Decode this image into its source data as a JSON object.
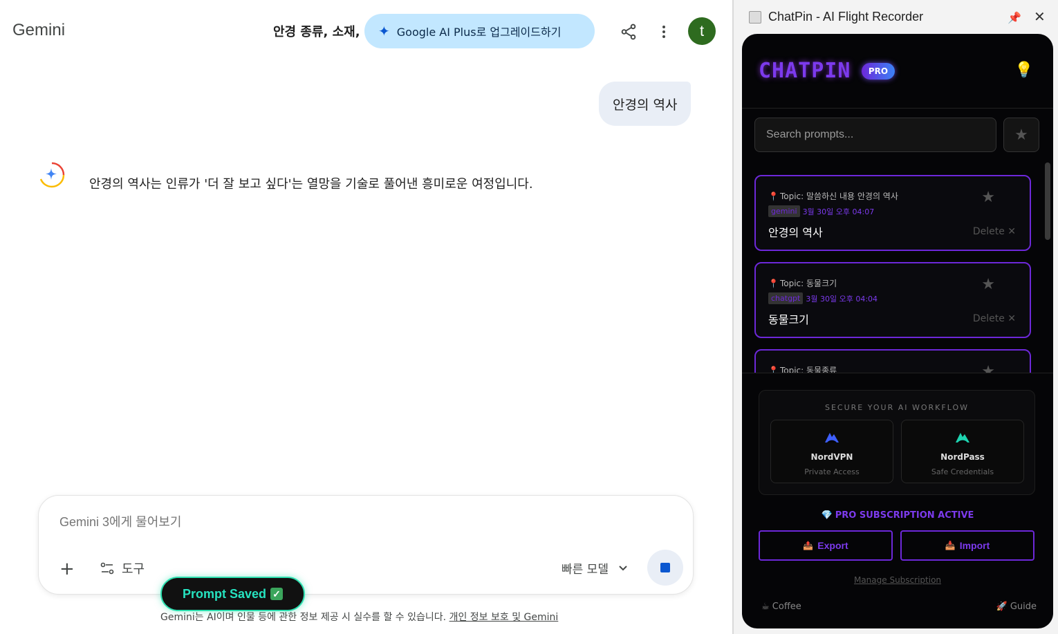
{
  "gemini": {
    "logo": "Gemini",
    "conversation_title": "안경 종류, 소재,",
    "upgrade_label": "Google AI Plus로 업그레이드하기",
    "avatar_initial": "t",
    "user_message": "안경의 역사",
    "answer": "안경의 역사는 인류가 '더 잘 보고 싶다'는 열망을 기술로 풀어낸 흥미로운 여정입니다.",
    "composer": {
      "placeholder": "Gemini 3에게 물어보기",
      "tools_label": "도구",
      "model_label": "빠른 모델"
    },
    "toast": "Prompt Saved",
    "disclaimer": "Gemini는 AI이며 인물 등에 관한 정보 제공 시 실수를 할 수 있습니다.",
    "disclaimer_link": "개인 정보 보호 및 Gemini"
  },
  "chatpin": {
    "window_title": "ChatPin - AI Flight Recorder",
    "brand": "CHATPIN",
    "badge": "PRO",
    "search_placeholder": "Search prompts...",
    "prompts": [
      {
        "topic": "Topic: 말씀하신 내용 안경의 역사",
        "tag": "gemini",
        "date": "3월 30일 오후 04:07",
        "title": "안경의 역사",
        "delete": "Delete"
      },
      {
        "topic": "Topic: 동물크기",
        "tag": "chatgpt",
        "date": "3월 30일 오후 04:04",
        "title": "동물크기",
        "delete": "Delete"
      },
      {
        "topic": "Topic: 동물종류",
        "tag": "",
        "date": "",
        "title": "",
        "delete": ""
      }
    ],
    "secure": {
      "title": "SECURE YOUR AI WORKFLOW",
      "vpn_name": "NordVPN",
      "vpn_sub": "Private Access",
      "pass_name": "NordPass",
      "pass_sub": "Safe Credentials"
    },
    "pro_status": "PRO SUBSCRIPTION ACTIVE",
    "export_label": "Export",
    "import_label": "Import",
    "manage_label": "Manage Subscription",
    "coffee_label": "Coffee",
    "guide_label": "Guide"
  },
  "colors": {
    "accent_purple": "#7c3aed",
    "upgrade_bg": "#c2e7ff",
    "avatar_bg": "#2e6b1f",
    "toast_border": "#2de0b0"
  }
}
